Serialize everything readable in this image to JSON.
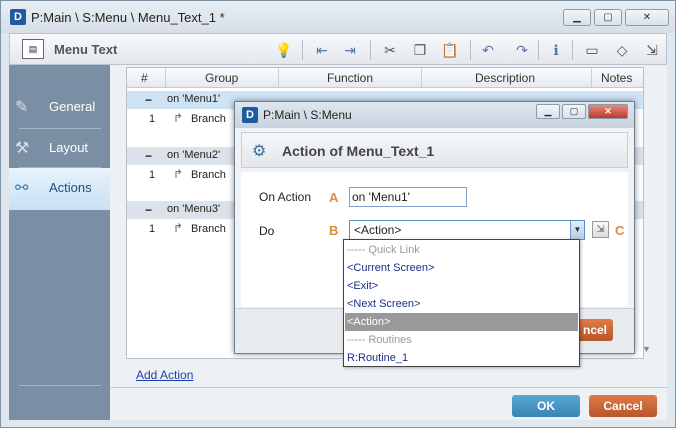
{
  "window": {
    "icon_letter": "D",
    "title": "P:Main \\ S:Menu \\ Menu_Text_1 *",
    "min_glyph": "▁",
    "max_glyph": "▢",
    "close_glyph": "✕"
  },
  "toolbar": {
    "icon_text": "▤",
    "title": "Menu Text"
  },
  "sidebar": {
    "items": [
      {
        "label": "General",
        "icon": "wrench-icon",
        "glyph": "✎"
      },
      {
        "label": "Layout",
        "icon": "tools-icon",
        "glyph": "⚒"
      },
      {
        "label": "Actions",
        "icon": "link-icon",
        "glyph": "⚯"
      }
    ]
  },
  "grid": {
    "columns": [
      "#",
      "Group",
      "Function",
      "Description",
      "Notes"
    ],
    "groups": [
      {
        "label": "on 'Menu1'",
        "rows": [
          {
            "num": "1",
            "text": "Branch"
          }
        ]
      },
      {
        "label": "on 'Menu2'",
        "rows": [
          {
            "num": "1",
            "text": "Branch"
          }
        ]
      },
      {
        "label": "on 'Menu3'",
        "rows": [
          {
            "num": "1",
            "text": "Branch"
          }
        ]
      }
    ]
  },
  "add_action": "Add Action",
  "buttons": {
    "ok": "OK",
    "cancel": "Cancel"
  },
  "dialog": {
    "title": "P:Main \\ S:Menu",
    "header": "Action of Menu_Text_1",
    "on_action_label": "On Action",
    "on_action_value": "on 'Menu1'",
    "do_label": "Do",
    "do_value": "<Action>",
    "letters": [
      "A",
      "B",
      "C"
    ],
    "cancel_partial": "ncel",
    "dropdown_options": [
      {
        "text": "----- Quick Link",
        "type": "header"
      },
      {
        "text": "<Current Screen>",
        "type": "item"
      },
      {
        "text": "<Exit>",
        "type": "item"
      },
      {
        "text": "<Next Screen>",
        "type": "item"
      },
      {
        "text": "<Action>",
        "type": "selected"
      },
      {
        "text": "----- Routines",
        "type": "header"
      },
      {
        "text": "R:Routine_1",
        "type": "item"
      }
    ]
  }
}
